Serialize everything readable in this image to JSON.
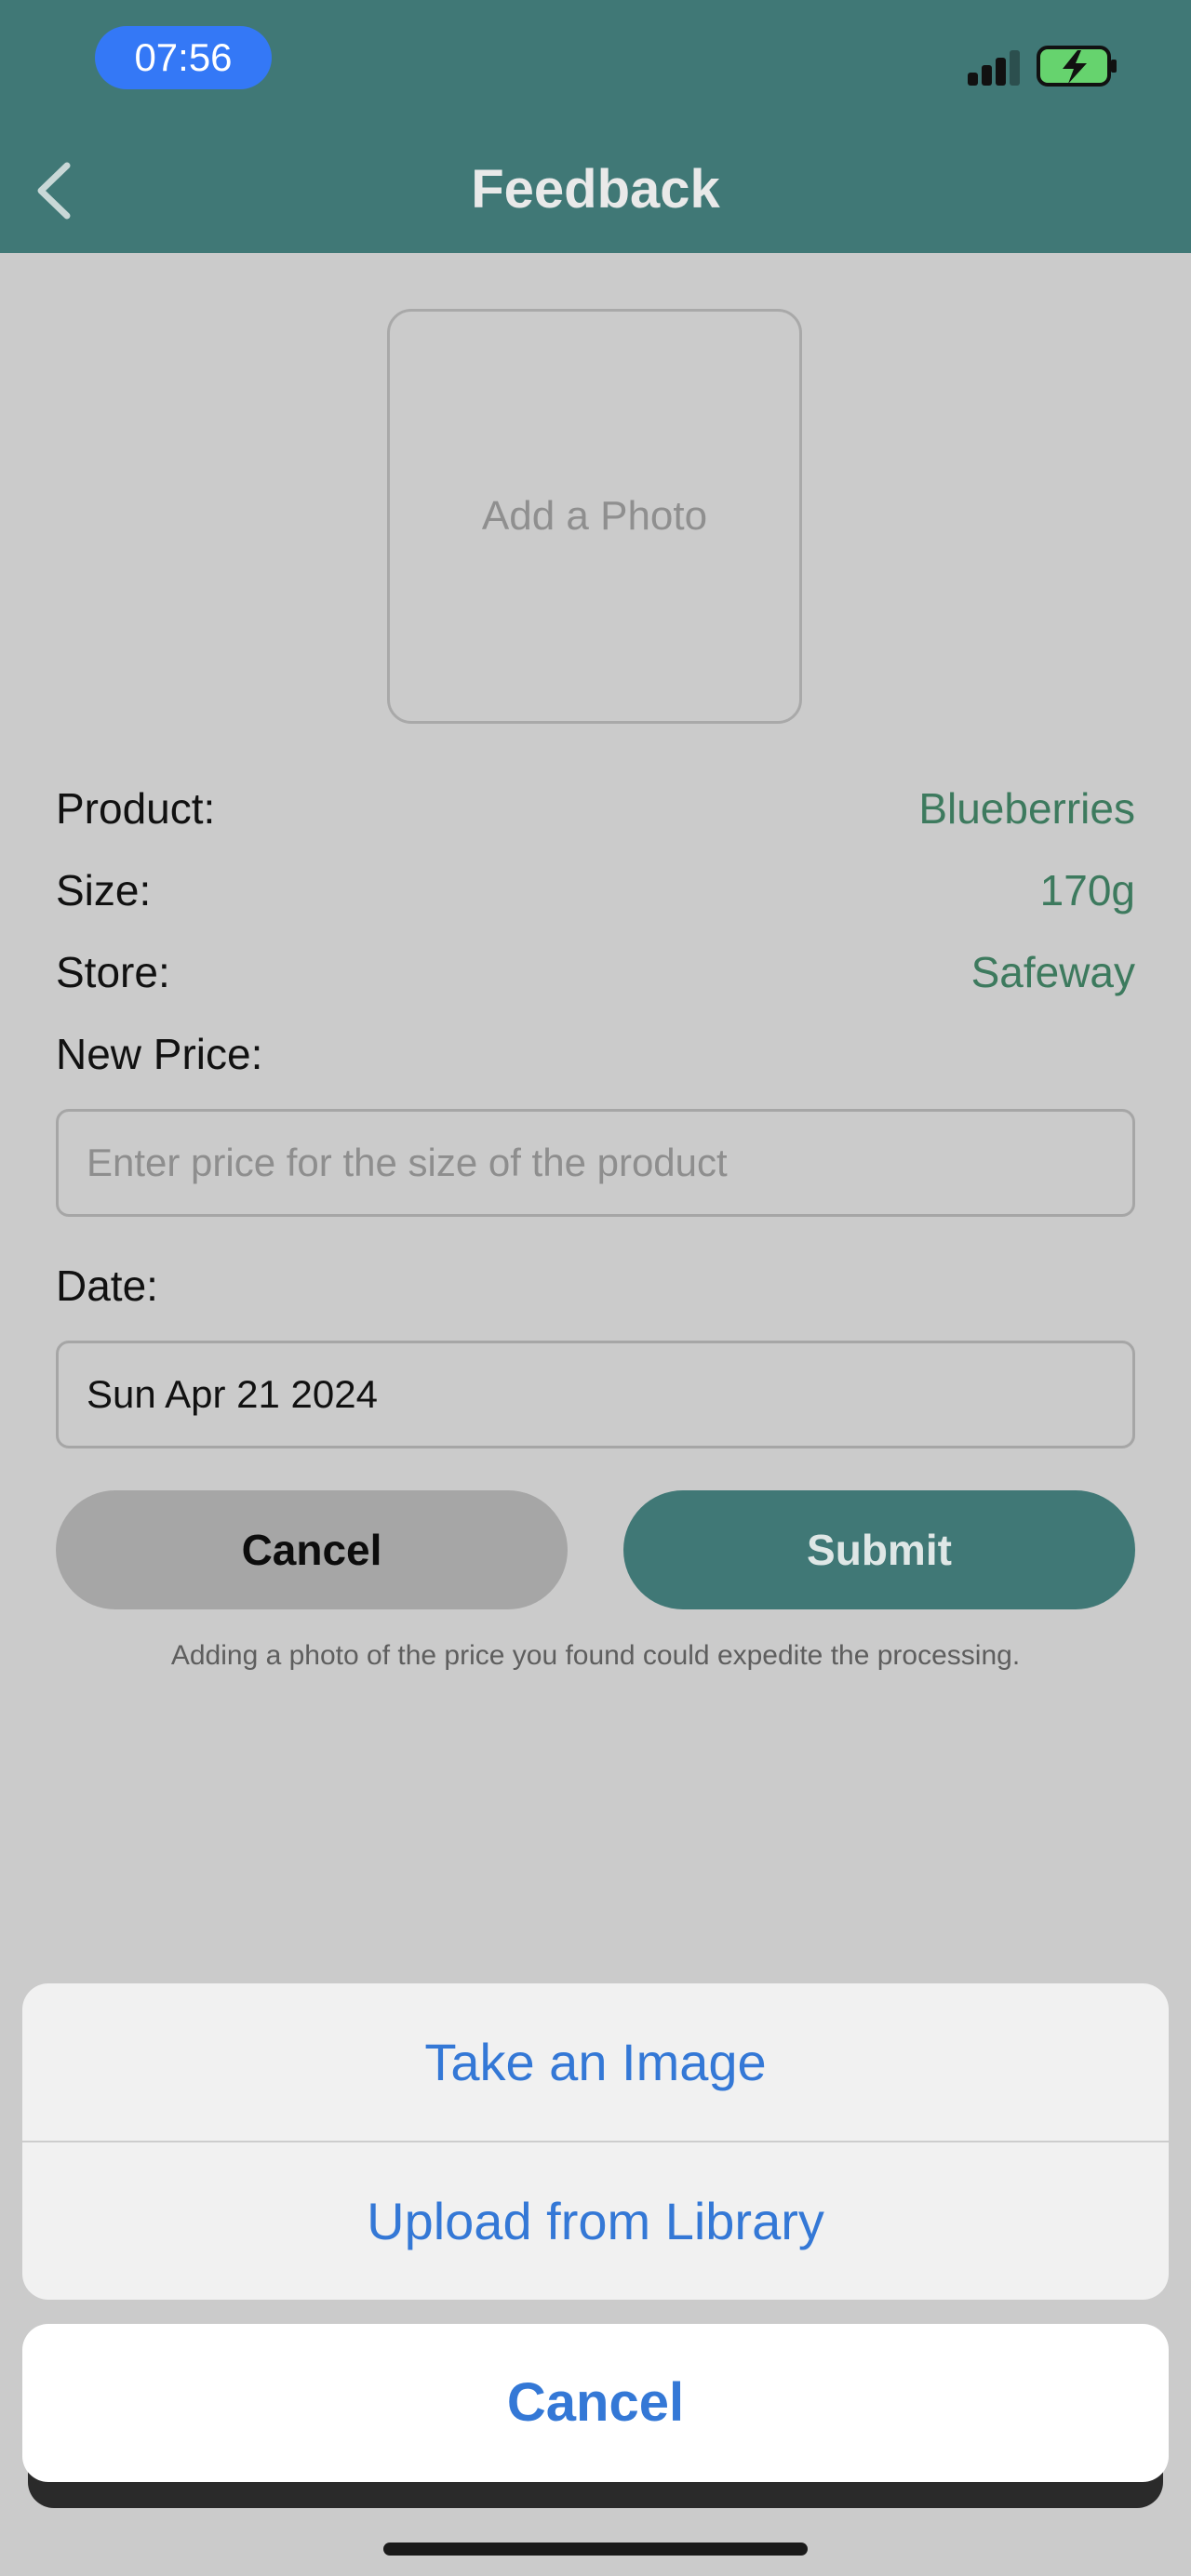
{
  "status_bar": {
    "time": "07:56"
  },
  "header": {
    "title": "Feedback"
  },
  "photo": {
    "label": "Add a Photo"
  },
  "details": [
    {
      "label": "Product:",
      "value": "Blueberries"
    },
    {
      "label": "Size:",
      "value": "170g"
    },
    {
      "label": "Store:",
      "value": "Safeway"
    }
  ],
  "new_price": {
    "label": "New Price:",
    "placeholder": "Enter price for the size of the product"
  },
  "date": {
    "label": "Date:",
    "value": "Sun Apr 21 2024"
  },
  "buttons": {
    "cancel": "Cancel",
    "submit": "Submit"
  },
  "hint": "Adding a photo of the price you found could expedite the processing.",
  "action_sheet": {
    "options": [
      "Take an Image",
      "Upload from Library"
    ],
    "cancel": "Cancel"
  },
  "colors": {
    "header": "#407876",
    "accent_value": "#3d7a5e",
    "action_blue": "#3478d6",
    "time_pill": "#3478f6"
  },
  "icons": [
    "back-chevron-icon",
    "signal-icon",
    "battery-charging-icon"
  ]
}
